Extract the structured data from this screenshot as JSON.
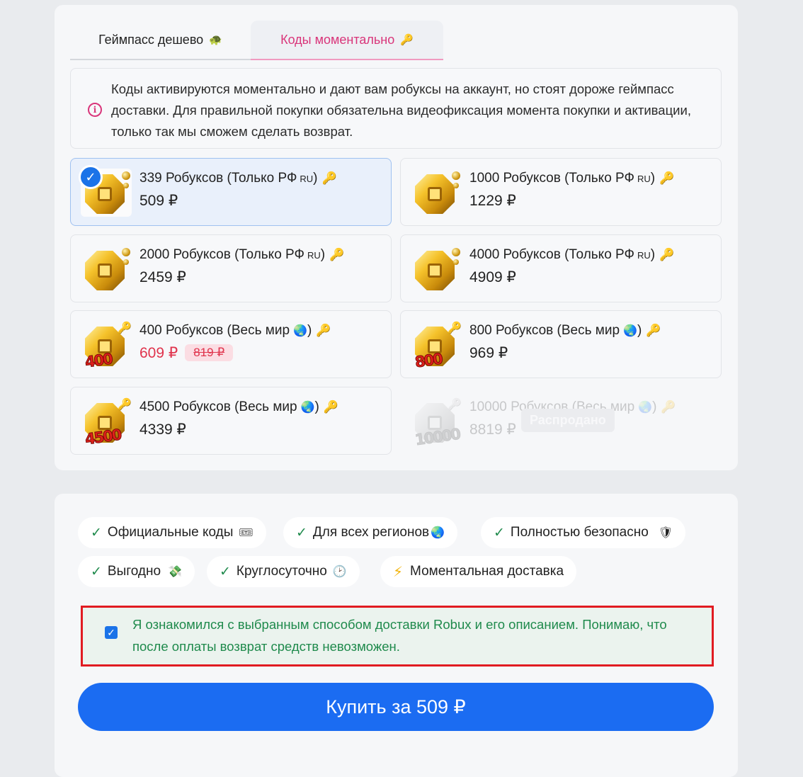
{
  "tabs": [
    {
      "label": "Геймпасс дешево",
      "emoji": "🐢"
    },
    {
      "label": "Коды моментально",
      "emoji": "🔑"
    }
  ],
  "notice": {
    "icon": "info-icon",
    "text": "Коды активируются моментально и дают вам робуксы на аккаунт, но стоят дороже геймпасс доставки. Для правильной покупки обязательна видеофиксация момента покупки и активации, только так мы сможем сделать возврат."
  },
  "products": [
    {
      "title": "339 Робуксов (Только РФ",
      "sub": "RU",
      "price": "509 ₽",
      "selected": true
    },
    {
      "title": "1000 Робуксов (Только РФ",
      "sub": "RU",
      "price": "1229 ₽"
    },
    {
      "title": "2000 Робуксов (Только РФ",
      "sub": "RU",
      "price": "2459 ₽"
    },
    {
      "title": "4000 Робуксов (Только РФ",
      "sub": "RU",
      "price": "4909 ₽"
    },
    {
      "title": "400 Робуксов (Весь мир",
      "price": "609 ₽",
      "old_price": "819 ₽",
      "badge": "400"
    },
    {
      "title": "800 Робуксов (Весь мир",
      "price": "969 ₽",
      "badge": "800"
    },
    {
      "title": "4500 Робуксов (Весь мир",
      "price": "4339 ₽",
      "badge": "4500"
    },
    {
      "title": "10000 Робуксов (Весь мир",
      "price": "8819 ₽",
      "badge": "10000",
      "soldout_label": "Распродано"
    }
  ],
  "title_close": ")",
  "features": [
    {
      "label": "Официальные коды",
      "emoji": "🎟"
    },
    {
      "label": "Для всех регионов",
      "emoji": "🌏"
    },
    {
      "label": "Полностью безопасно",
      "emoji": "🛡"
    },
    {
      "label": "Выгодно",
      "emoji": "💸"
    },
    {
      "label": "Круглосуточно",
      "emoji": "🕑"
    },
    {
      "label": "Моментальная доставка"
    }
  ],
  "consent": {
    "checked": true,
    "text": "Я ознакомился с выбранным способом доставки Robux и его описанием. Понимаю, что после оплаты возврат средств невозможен."
  },
  "buy_button": {
    "label": "Купить за 509 ₽"
  },
  "colors": {
    "accent": "#1b6cf2",
    "tab_active": "#d9357a",
    "sale": "#e0344d",
    "success": "#1f8a4c",
    "highlight_border": "#e11b22"
  }
}
